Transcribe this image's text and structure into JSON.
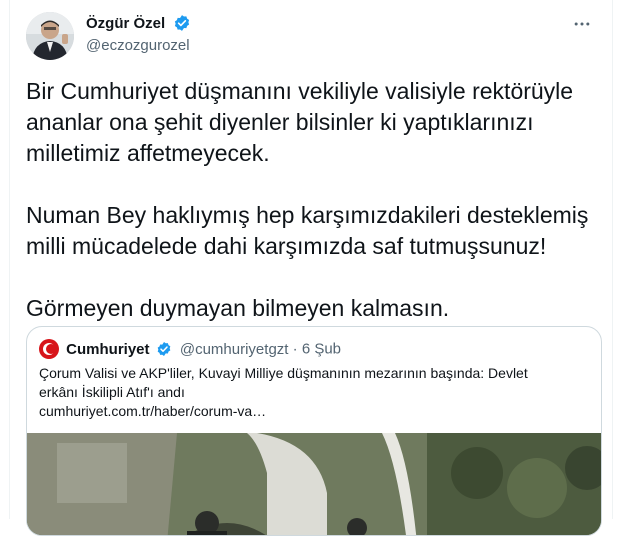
{
  "tweet": {
    "author": {
      "display_name": "Özgür Özel",
      "handle": "@eczozgurozel",
      "verified": true,
      "avatar_icon": "avatar-photo"
    },
    "more_icon": "more-horizontal-icon",
    "paragraphs": [
      [
        "Bir Cumhuriyet düşmanını vekiliyle valisiyle rektörüyle",
        "ananlar ona şehit diyenler bilsinler ki yaptıklarınızı",
        "milletimiz affetmeyecek."
      ],
      [
        "Numan Bey haklıymış hep karşımızdakileri desteklemiş",
        "milli mücadelede dahi karşımızda saf tutmuşsunuz!"
      ],
      [
        "Görmeyen duymayan bilmeyen kalmasın."
      ]
    ]
  },
  "quoted_tweet": {
    "author": {
      "display_name": "Cumhuriyet",
      "handle": "@cumhuriyetgzt",
      "separator": "·",
      "date": "6 Şub",
      "verified": true,
      "logo_icon": "cumhuriyet-logo-icon"
    },
    "text_lines": [
      "Çorum Valisi ve AKP'liler, Kuvayi Milliye düşmanının mezarının başında: Devlet",
      "erkânı İskilipli Atıf'ı andı"
    ],
    "link": "cumhuriyet.com.tr/haber/corum-va…"
  },
  "colors": {
    "verified_blue": "#1d9bf0",
    "cumhuriyet_red": "#d7141a",
    "secondary_text": "#536471",
    "border": "#cfd9de"
  }
}
